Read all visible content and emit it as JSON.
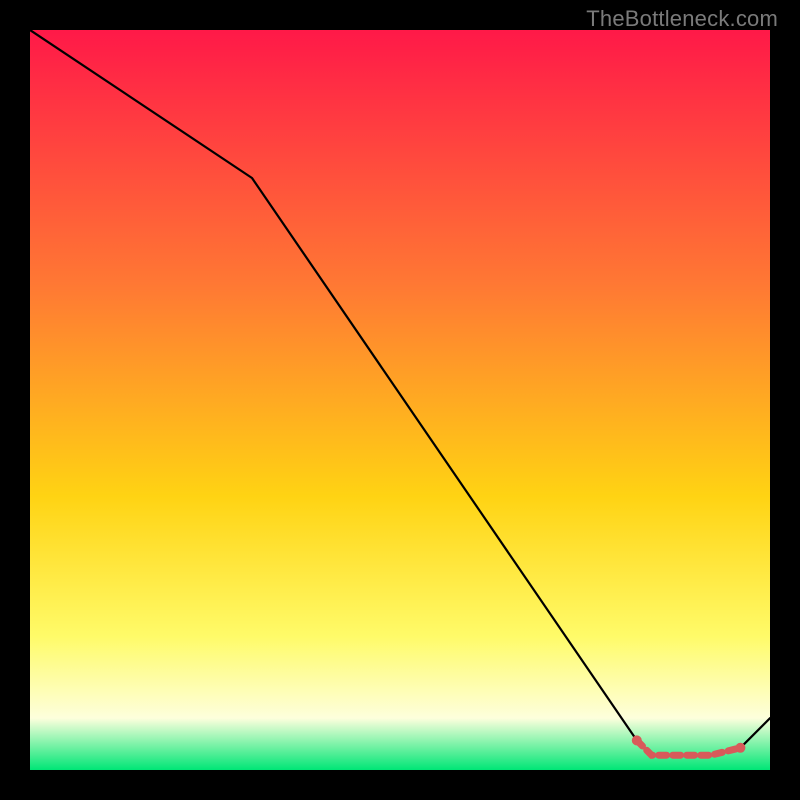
{
  "attribution": "TheBottleneck.com",
  "colors": {
    "gradient_top": "#ff1948",
    "gradient_mid_upper": "#ff7a33",
    "gradient_mid": "#ffd313",
    "gradient_mid_lower": "#fffb69",
    "gradient_lower": "#fdffdc",
    "gradient_bottom": "#00e676",
    "line": "#000000",
    "segment": "#d85a5a",
    "frame": "#000000"
  },
  "chart_data": {
    "type": "line",
    "title": "",
    "xlabel": "",
    "ylabel": "",
    "xlim": [
      0,
      100
    ],
    "ylim": [
      0,
      100
    ],
    "series": [
      {
        "name": "bottleneck-curve",
        "x": [
          0,
          30,
          82,
          84,
          92,
          96,
          100
        ],
        "y": [
          100,
          80,
          4,
          2,
          2,
          3,
          7
        ]
      }
    ],
    "highlighted_segment": {
      "name": "optimal-band",
      "x": [
        82,
        84,
        92,
        96
      ],
      "y": [
        4,
        2,
        2,
        3
      ]
    }
  }
}
